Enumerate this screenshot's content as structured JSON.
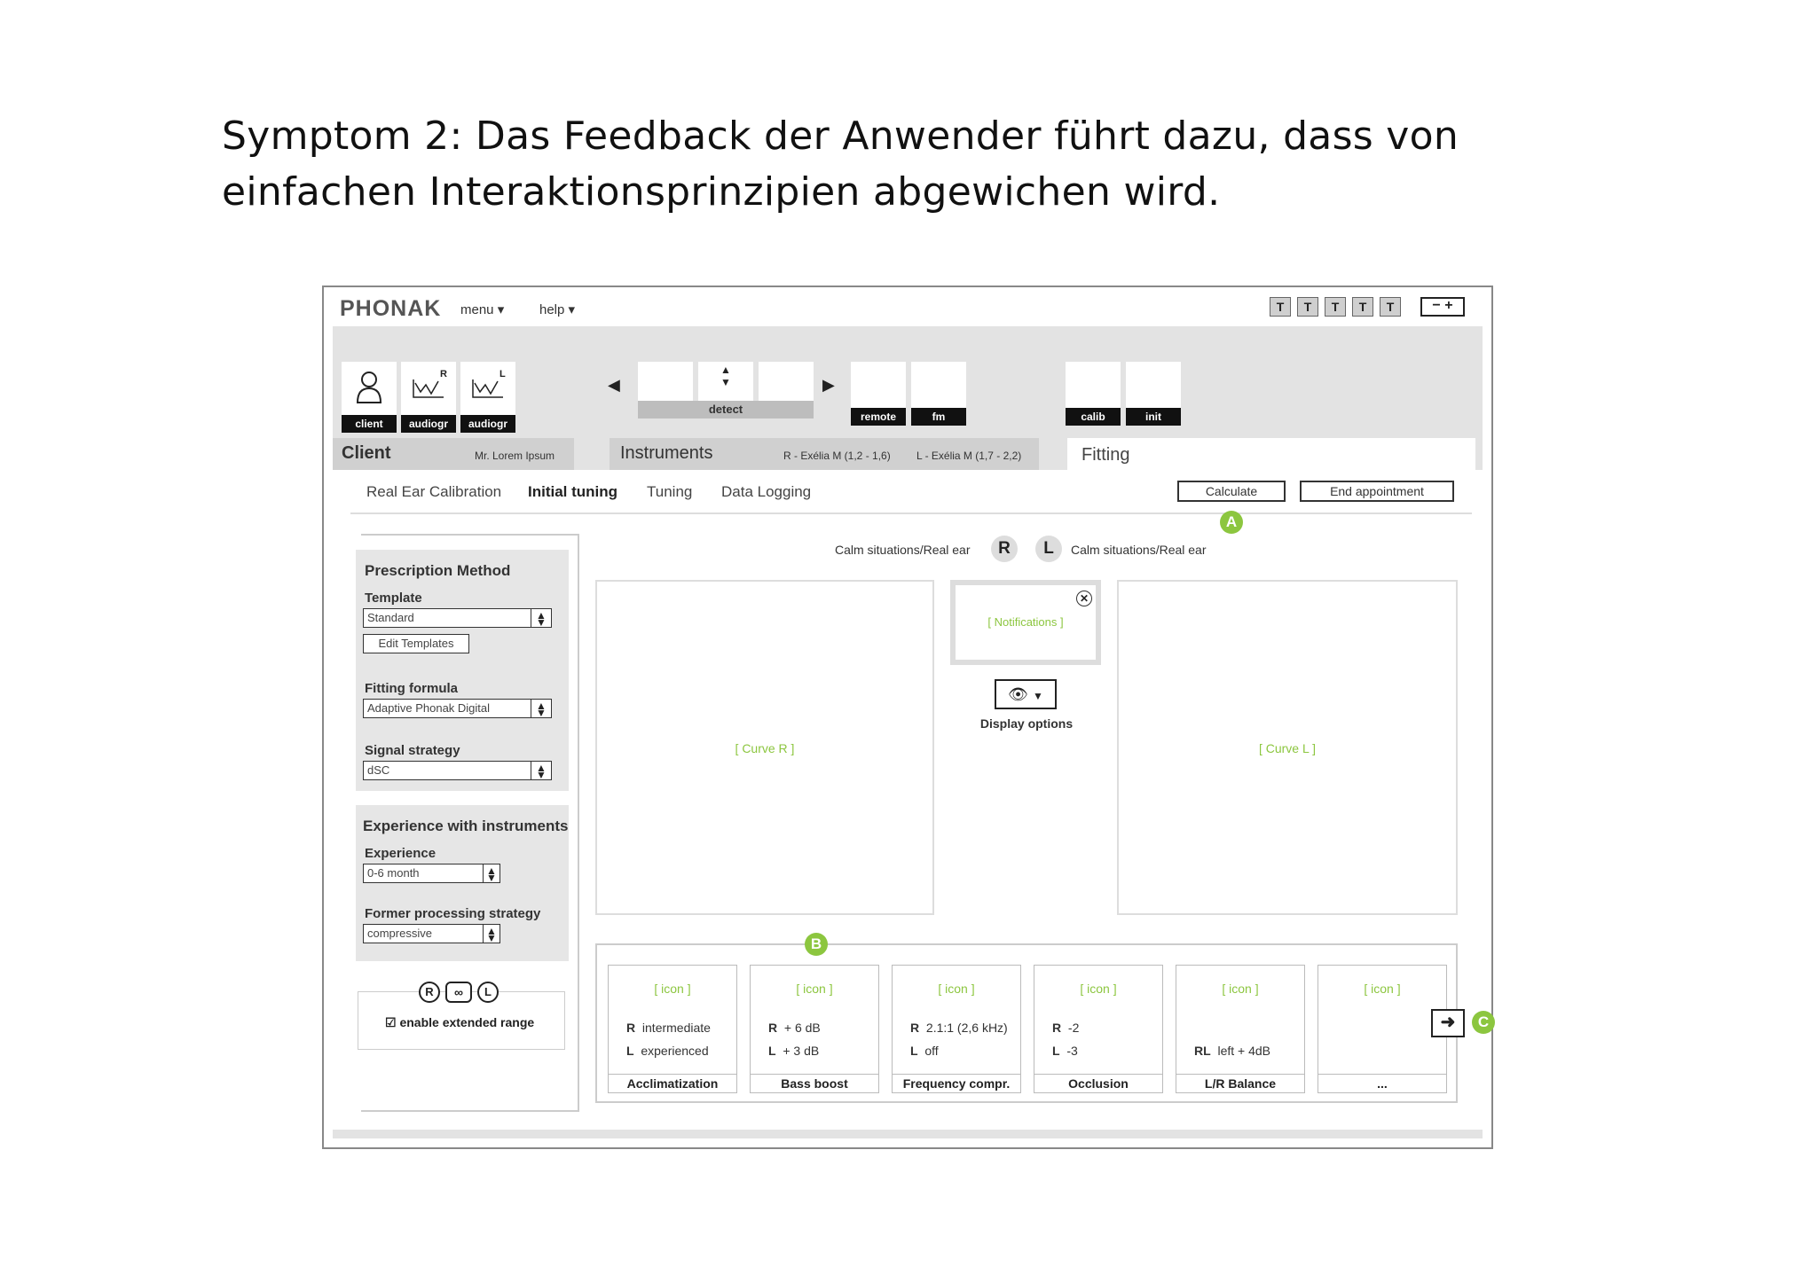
{
  "heading": {
    "line1": "Symptom 2: Das Feedback der Anwender führt dazu, dass von",
    "line2": "einfachen Interaktionsprinzipien abgewichen wird."
  },
  "app": {
    "logo": "PHONAK",
    "menu_label": "menu",
    "help_label": "help",
    "text_size_buttons": [
      "T",
      "T",
      "T",
      "T",
      "T"
    ],
    "zoom_label": "− +"
  },
  "toolbar": {
    "client_label": "client",
    "audiogram_r_label": "audiogr",
    "audiogram_l_label": "audiogr",
    "audiogram_r_tag": "R",
    "audiogram_l_tag": "L",
    "detect_label": "detect",
    "remote_label": "remote",
    "fm_label": "fm",
    "calib_label": "calib",
    "init_label": "init"
  },
  "tabs": {
    "client_title": "Client",
    "client_name": "Mr. Lorem Ipsum",
    "instruments_title": "Instruments",
    "instrument_r": "R - Exélia M (1,2 - 1,6)",
    "instrument_l": "L - Exélia M (1,7 - 2,2)",
    "fitting_title": "Fitting"
  },
  "subnav": {
    "items": [
      "Real Ear Calibration",
      "Initial tuning",
      "Tuning",
      "Data Logging"
    ],
    "active": "Initial tuning",
    "calculate_label": "Calculate",
    "end_label": "End appointment"
  },
  "badges": {
    "a": "A",
    "b": "B",
    "c": "C"
  },
  "left_panel": {
    "prescription_title": "Prescription Method",
    "template_label": "Template",
    "template_value": "Standard",
    "edit_templates_label": "Edit Templates",
    "formula_label": "Fitting formula",
    "formula_value": "Adaptive Phonak Digital",
    "signal_label": "Signal strategy",
    "signal_value": "dSC",
    "experience_title": "Experience with instruments",
    "experience_label": "Experience",
    "experience_value": "0-6 month",
    "former_label": "Former processing strategy",
    "former_value": "compressive",
    "extended_range_label": "enable extended range",
    "ear_r": "R",
    "ear_l": "L",
    "ear_both": "∞"
  },
  "center": {
    "situation_r": "Calm situations/Real ear",
    "situation_l": "Calm situations/Real ear",
    "r_label": "R",
    "l_label": "L",
    "curve_r": "[ Curve R ]",
    "curve_l": "[ Curve L ]",
    "notifications": "[ Notifications ]",
    "display_options": "Display options"
  },
  "cards": [
    {
      "icon": "[ icon ]",
      "r_key": "R",
      "r_val": "intermediate",
      "l_key": "L",
      "l_val": "experienced",
      "footer": "Acclimatization"
    },
    {
      "icon": "[ icon ]",
      "r_key": "R",
      "r_val": "+ 6 dB",
      "l_key": "L",
      "l_val": "+ 3 dB",
      "footer": "Bass boost"
    },
    {
      "icon": "[ icon ]",
      "r_key": "R",
      "r_val": "2.1:1 (2,6 kHz)",
      "l_key": "L",
      "l_val": "off",
      "footer": "Frequency compr."
    },
    {
      "icon": "[ icon ]",
      "r_key": "R",
      "r_val": "-2",
      "l_key": "L",
      "l_val": "-3",
      "footer": "Occlusion"
    },
    {
      "icon": "[ icon ]",
      "rl_key": "RL",
      "rl_val": "left + 4dB",
      "footer": "L/R Balance"
    },
    {
      "icon": "[ icon ]",
      "footer": "..."
    }
  ]
}
